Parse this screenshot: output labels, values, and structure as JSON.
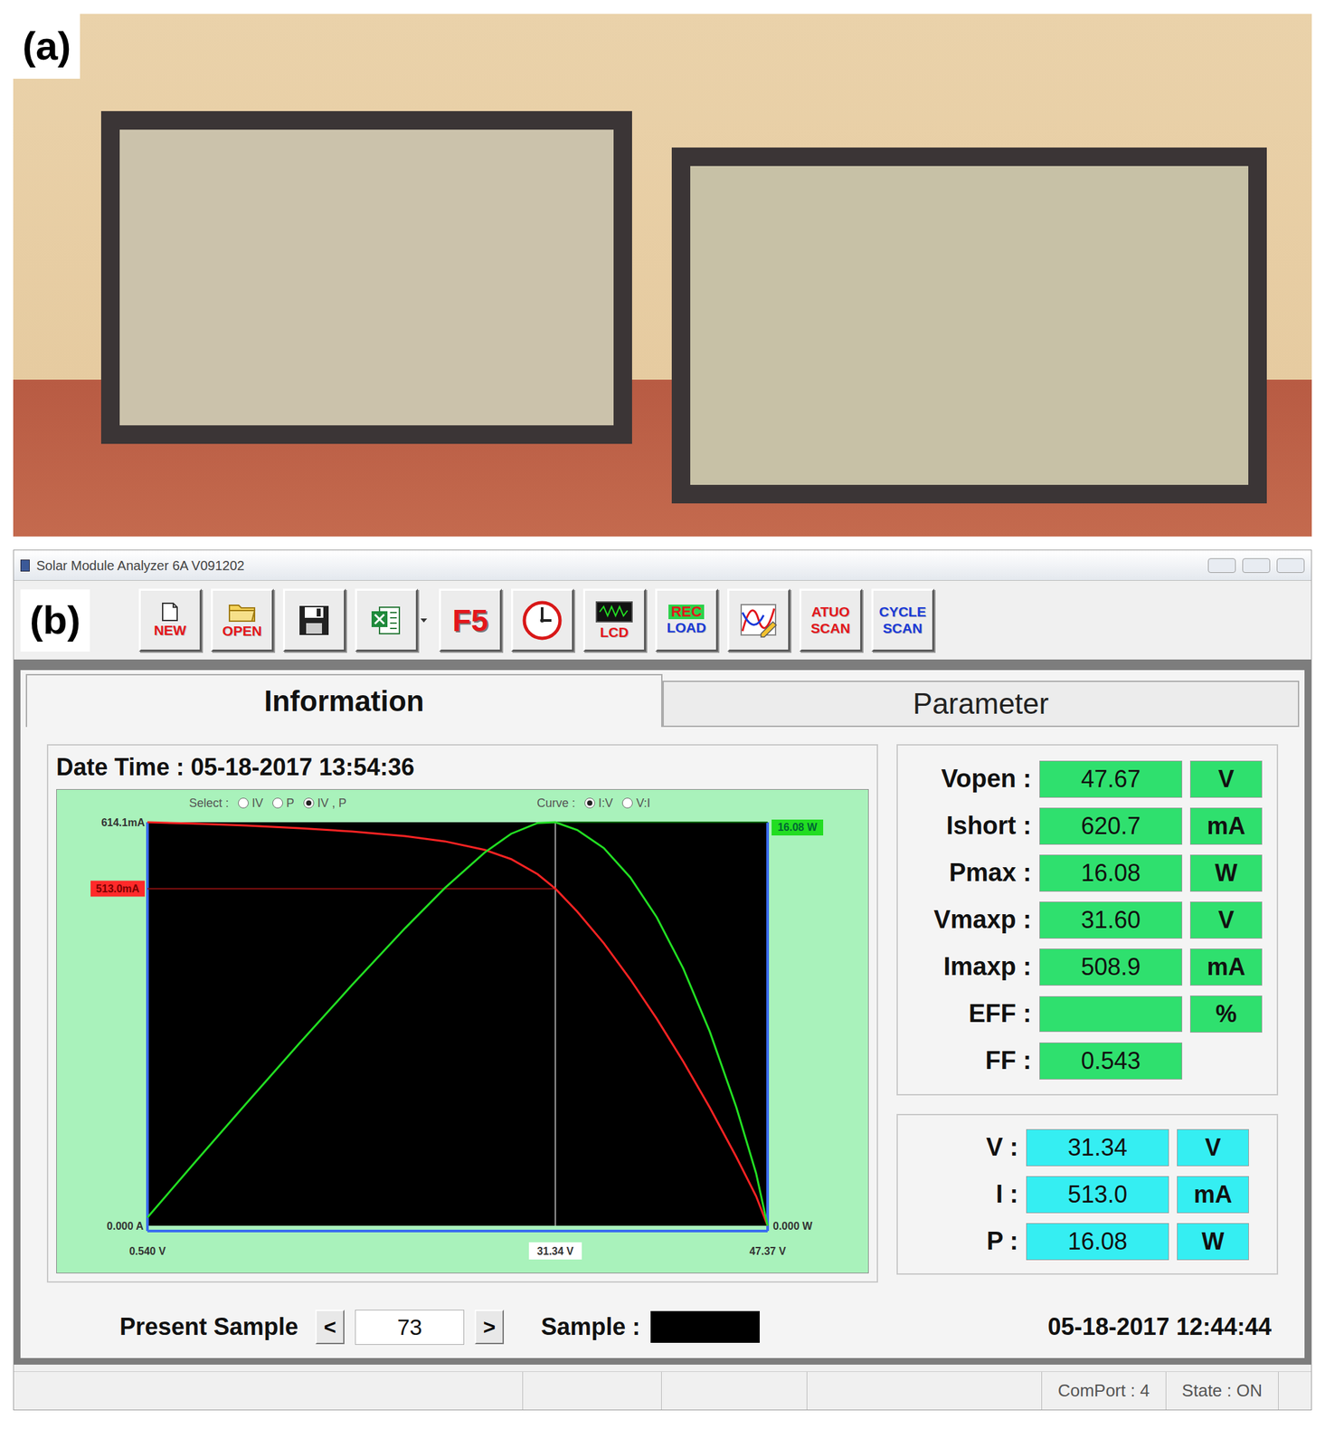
{
  "figure_labels": {
    "photo": "(a)",
    "screenshot": "(b)"
  },
  "window": {
    "title": "Solar Module Analyzer 6A V091202"
  },
  "toolbar": [
    {
      "kind": "new",
      "lines": [
        {
          "text": "NEW",
          "color": "#e3161b"
        }
      ],
      "dropdown": false
    },
    {
      "kind": "open",
      "lines": [
        {
          "text": "OPEN",
          "color": "#e3161b"
        }
      ],
      "dropdown": false
    },
    {
      "kind": "save",
      "lines": [],
      "dropdown": false
    },
    {
      "kind": "excel",
      "lines": [],
      "dropdown": true
    },
    {
      "kind": "refresh",
      "lines": [
        {
          "text": "F5",
          "color": "#e3161b"
        }
      ],
      "dropdown": false
    },
    {
      "kind": "clock",
      "lines": [],
      "dropdown": false
    },
    {
      "kind": "lcd",
      "lines": [
        {
          "text": "LCD",
          "color": "#e3161b"
        }
      ],
      "dropdown": false
    },
    {
      "kind": "rec",
      "lines": [
        {
          "text": "REC",
          "color": "#e3161b"
        },
        {
          "text": "LOAD",
          "color": "#1a3ad8"
        }
      ],
      "dropdown": false
    },
    {
      "kind": "scope",
      "lines": [],
      "dropdown": false
    },
    {
      "kind": "scan",
      "lines": [
        {
          "text": "ATUO",
          "color": "#e3161b"
        },
        {
          "text": "SCAN",
          "color": "#e3161b"
        }
      ],
      "dropdown": false
    },
    {
      "kind": "scan",
      "lines": [
        {
          "text": "CYCLE",
          "color": "#1a3ad8"
        },
        {
          "text": "SCAN",
          "color": "#1a3ad8"
        }
      ],
      "dropdown": false
    }
  ],
  "tabs": [
    {
      "label": "Information",
      "selected": true
    },
    {
      "label": "Parameter",
      "selected": false
    }
  ],
  "info": {
    "label": "Date Time :",
    "value": "05-18-2017 13:54:36"
  },
  "chart": {
    "select": {
      "label": "Select :",
      "options": [
        {
          "label": "IV",
          "selected": false
        },
        {
          "label": "P",
          "selected": false
        },
        {
          "label": "IV , P",
          "selected": true
        }
      ]
    },
    "curve": {
      "label": "Curve :",
      "options": [
        {
          "label": "I:V",
          "selected": true
        },
        {
          "label": "V:I",
          "selected": false
        }
      ]
    },
    "y_left_ticks": {
      "max": "614.1mA",
      "min": "0.000 A"
    },
    "y_right_ticks": {
      "max": "16.08 W",
      "min": "0.000 W"
    },
    "x_ticks": {
      "min": "0.540 V",
      "max": "47.37 V"
    },
    "x_min": 0.54,
    "x_max": 47.37,
    "y_left_max": 614.1,
    "y_right_max": 16.08,
    "voltage": [
      0.54,
      4,
      8,
      12,
      16,
      20,
      23,
      26,
      28,
      30,
      31.34,
      33,
      35,
      37,
      39,
      41,
      43,
      45,
      46.5,
      47.37
    ],
    "series": [
      {
        "values": [
          614.1,
          612,
          609,
          605,
          600,
          593,
          585,
          572,
          558,
          535,
          513.0,
          478,
          430,
          375,
          315,
          250,
          180,
          105,
          45,
          0
        ],
        "color": "#ff2323",
        "axis": "left"
      },
      {
        "values": [
          0.33,
          2.45,
          4.87,
          7.26,
          9.6,
          11.86,
          13.46,
          14.87,
          15.62,
          16.05,
          16.08,
          15.77,
          15.05,
          13.88,
          12.29,
          10.25,
          7.74,
          4.73,
          2.09,
          0
        ],
        "color": "#22dd22",
        "axis": "right"
      }
    ],
    "cursor": {
      "voltage": 31.34,
      "current": 513.0,
      "voltage_label": "31.34 V",
      "current_label": "513.0mA"
    }
  },
  "params": [
    {
      "label": "Vopen :",
      "value": "47.67",
      "unit": "V"
    },
    {
      "label": "Ishort :",
      "value": "620.7",
      "unit": "mA"
    },
    {
      "label": "Pmax :",
      "value": "16.08",
      "unit": "W"
    },
    {
      "label": "Vmaxp :",
      "value": "31.60",
      "unit": "V"
    },
    {
      "label": "Imaxp :",
      "value": "508.9",
      "unit": "mA"
    },
    {
      "label": "EFF :",
      "value": "",
      "unit": "%"
    },
    {
      "label": "FF :",
      "value": "0.543",
      "unit": null
    }
  ],
  "readout": [
    {
      "label": "V :",
      "value": "31.34",
      "unit": "V"
    },
    {
      "label": "I :",
      "value": "513.0",
      "unit": "mA"
    },
    {
      "label": "P :",
      "value": "16.08",
      "unit": "W"
    }
  ],
  "footer": {
    "present_sample_label": "Present Sample",
    "prev": "<",
    "sample_number": "73",
    "next": ">",
    "sample_label": "Sample :",
    "timestamp": "05-18-2017 12:44:44"
  },
  "status_bar": [
    "ComPort : 4",
    "State : ON"
  ]
}
